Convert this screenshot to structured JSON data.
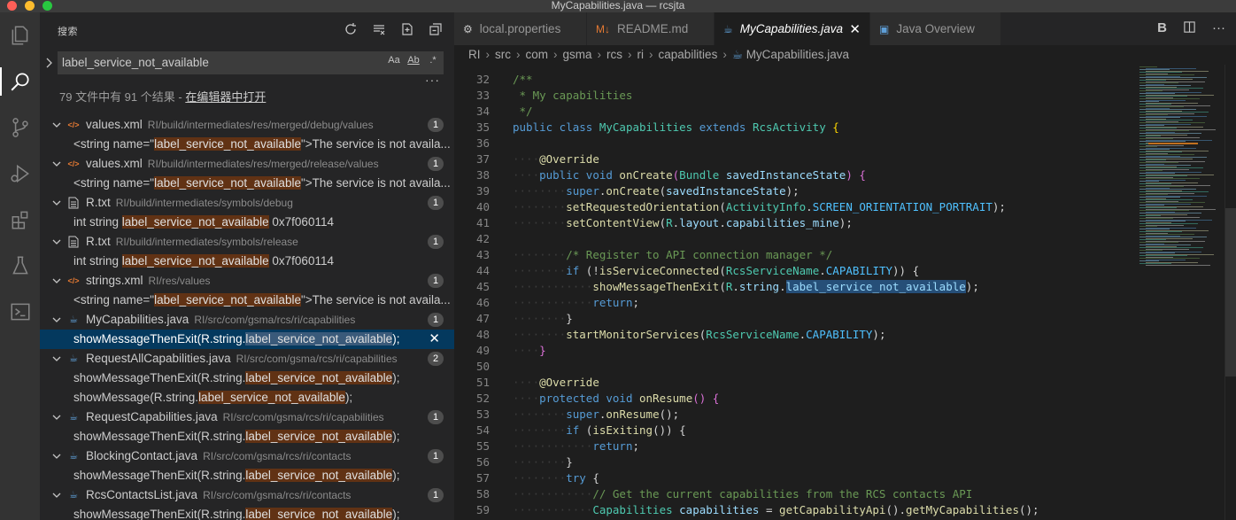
{
  "window": {
    "title": "MyCapabilities.java — rcsjta"
  },
  "activity_bar": [
    "files-icon",
    "search-icon",
    "source-control-icon",
    "run-debug-icon",
    "extensions-icon",
    "flask-icon",
    "terminal-icon"
  ],
  "sidebar": {
    "title": "搜索",
    "search": {
      "value": "label_service_not_available",
      "opt_case": "Aa",
      "opt_word": "Ab",
      "opt_regex": ".*"
    },
    "summary": {
      "text": "79 文件中有 91 个结果 - ",
      "link": "在编辑器中打开"
    },
    "results": [
      {
        "kind": "file",
        "icon": "xml",
        "name": "values.xml",
        "path": "RI/build/intermediates/res/merged/debug/values",
        "count": "1"
      },
      {
        "kind": "match",
        "pre": "<string name=\"",
        "hl": "label_service_not_available",
        "post": "\">The service is not availa..."
      },
      {
        "kind": "file",
        "icon": "xml",
        "name": "values.xml",
        "path": "RI/build/intermediates/res/merged/release/values",
        "count": "1"
      },
      {
        "kind": "match",
        "pre": "<string name=\"",
        "hl": "label_service_not_available",
        "post": "\">The service is not availa..."
      },
      {
        "kind": "file",
        "icon": "txt",
        "name": "R.txt",
        "path": "RI/build/intermediates/symbols/debug",
        "count": "1"
      },
      {
        "kind": "match",
        "pre": "int string ",
        "hl": "label_service_not_available",
        "post": " 0x7f060114"
      },
      {
        "kind": "file",
        "icon": "txt",
        "name": "R.txt",
        "path": "RI/build/intermediates/symbols/release",
        "count": "1"
      },
      {
        "kind": "match",
        "pre": "int string ",
        "hl": "label_service_not_available",
        "post": " 0x7f060114"
      },
      {
        "kind": "file",
        "icon": "xml",
        "name": "strings.xml",
        "path": "RI/res/values",
        "count": "1"
      },
      {
        "kind": "match",
        "pre": "<string name=\"",
        "hl": "label_service_not_available",
        "post": "\">The service is not availa..."
      },
      {
        "kind": "file",
        "icon": "java",
        "name": "MyCapabilities.java",
        "path": "RI/src/com/gsma/rcs/ri/capabilities",
        "count": "1"
      },
      {
        "kind": "match",
        "selected": true,
        "pre": "showMessageThenExit(R.string.",
        "hl": "label_service_not_available",
        "post": ");"
      },
      {
        "kind": "file",
        "icon": "java",
        "name": "RequestAllCapabilities.java",
        "path": "RI/src/com/gsma/rcs/ri/capabilities",
        "count": "2"
      },
      {
        "kind": "match",
        "pre": "showMessageThenExit(R.string.",
        "hl": "label_service_not_available",
        "post": ");"
      },
      {
        "kind": "match",
        "pre": "showMessage(R.string.",
        "hl": "label_service_not_available",
        "post": ");"
      },
      {
        "kind": "file",
        "icon": "java",
        "name": "RequestCapabilities.java",
        "path": "RI/src/com/gsma/rcs/ri/capabilities",
        "count": "1"
      },
      {
        "kind": "match",
        "pre": "showMessageThenExit(R.string.",
        "hl": "label_service_not_available",
        "post": ");"
      },
      {
        "kind": "file",
        "icon": "java",
        "name": "BlockingContact.java",
        "path": "RI/src/com/gsma/rcs/ri/contacts",
        "count": "1"
      },
      {
        "kind": "match",
        "pre": "showMessageThenExit(R.string.",
        "hl": "label_service_not_available",
        "post": ");"
      },
      {
        "kind": "file",
        "icon": "java",
        "name": "RcsContactsList.java",
        "path": "RI/src/com/gsma/rcs/ri/contacts",
        "count": "1"
      },
      {
        "kind": "match",
        "pre": "showMessageThenExit(R.string.",
        "hl": "label_service_not_available",
        "post": ");"
      }
    ]
  },
  "tabs": [
    {
      "label": "local.properties",
      "icon": "⚙",
      "active": false
    },
    {
      "label": "README.md",
      "icon": "M↓",
      "active": false
    },
    {
      "label": "MyCapabilities.java",
      "icon": "☕",
      "active": true
    },
    {
      "label": "Java Overview",
      "icon": "▣",
      "active": false
    }
  ],
  "tab_actions": [
    "B",
    "split-editor-icon",
    "more-icon"
  ],
  "breadcrumb": [
    "RI",
    "src",
    "com",
    "gsma",
    "rcs",
    "ri",
    "capabilities",
    "MyCapabilities.java"
  ],
  "code": [
    {
      "n": "32",
      "t": [
        [
          "c-com",
          "/**"
        ]
      ]
    },
    {
      "n": "33",
      "t": [
        [
          "c-com",
          " * My capabilities"
        ]
      ]
    },
    {
      "n": "34",
      "t": [
        [
          "c-com",
          " */"
        ]
      ]
    },
    {
      "n": "35",
      "t": [
        [
          "c-kw",
          "public"
        ],
        [
          "",
          ""
        ],
        [
          "c-kw",
          " class"
        ],
        [
          "c-cls",
          " MyCapabilities"
        ],
        [
          "c-kw",
          " extends"
        ],
        [
          "c-cls",
          " RcsActivity"
        ],
        [
          "c-brk",
          " {"
        ]
      ]
    },
    {
      "n": "36",
      "t": []
    },
    {
      "n": "37",
      "t": [
        [
          "ws",
          "····"
        ],
        [
          "c-ann",
          "@Override"
        ]
      ]
    },
    {
      "n": "38",
      "t": [
        [
          "ws",
          "····"
        ],
        [
          "c-kw",
          "public"
        ],
        [
          "c-kw",
          " void"
        ],
        [
          "c-fn",
          " onCreate"
        ],
        [
          "c-brk2",
          "("
        ],
        [
          "c-cls",
          "Bundle"
        ],
        [
          "c-var",
          " savedInstanceState"
        ],
        [
          "c-brk2",
          ")"
        ],
        [
          "c-brk2",
          " {"
        ]
      ]
    },
    {
      "n": "39",
      "t": [
        [
          "ws",
          "········"
        ],
        [
          "c-kw",
          "super"
        ],
        [
          "",
          "."
        ],
        [
          "c-fn",
          "onCreate"
        ],
        [
          "",
          "("
        ],
        [
          "c-var",
          "savedInstanceState"
        ],
        [
          "",
          ");"
        ]
      ]
    },
    {
      "n": "40",
      "t": [
        [
          "ws",
          "········"
        ],
        [
          "c-fn",
          "setRequestedOrientation"
        ],
        [
          "",
          "("
        ],
        [
          "c-cls",
          "ActivityInfo"
        ],
        [
          "",
          "."
        ],
        [
          "c-const",
          "SCREEN_ORIENTATION_PORTRAIT"
        ],
        [
          "",
          ");"
        ]
      ]
    },
    {
      "n": "41",
      "t": [
        [
          "ws",
          "········"
        ],
        [
          "c-fn",
          "setContentView"
        ],
        [
          "",
          "("
        ],
        [
          "c-cls",
          "R"
        ],
        [
          "",
          "."
        ],
        [
          "c-var",
          "layout"
        ],
        [
          "",
          "."
        ],
        [
          "c-var",
          "capabilities_mine"
        ],
        [
          "",
          ");"
        ]
      ]
    },
    {
      "n": "42",
      "t": []
    },
    {
      "n": "43",
      "t": [
        [
          "ws",
          "········"
        ],
        [
          "c-com",
          "/* Register to API connection manager */"
        ]
      ]
    },
    {
      "n": "44",
      "t": [
        [
          "ws",
          "········"
        ],
        [
          "c-kw",
          "if"
        ],
        [
          "",
          " ("
        ],
        [
          "",
          "!"
        ],
        [
          "c-fn",
          "isServiceConnected"
        ],
        [
          "",
          "("
        ],
        [
          "c-cls",
          "RcsServiceName"
        ],
        [
          "",
          "."
        ],
        [
          "c-const",
          "CAPABILITY"
        ],
        [
          "",
          "))"
        ],
        [
          "",
          " {"
        ]
      ]
    },
    {
      "n": "45",
      "t": [
        [
          "ws",
          "············"
        ],
        [
          "c-fn",
          "showMessageThenExit"
        ],
        [
          "",
          "("
        ],
        [
          "c-cls",
          "R"
        ],
        [
          "",
          "."
        ],
        [
          "c-var",
          "string"
        ],
        [
          "",
          "."
        ],
        [
          "c-var sel-hl",
          "label_service_not_available"
        ],
        [
          "",
          ");"
        ]
      ]
    },
    {
      "n": "46",
      "t": [
        [
          "ws",
          "············"
        ],
        [
          "c-kw",
          "return"
        ],
        [
          "",
          ";"
        ]
      ]
    },
    {
      "n": "47",
      "t": [
        [
          "ws",
          "········"
        ],
        [
          "",
          "}"
        ]
      ]
    },
    {
      "n": "48",
      "t": [
        [
          "ws",
          "········"
        ],
        [
          "c-fn",
          "startMonitorServices"
        ],
        [
          "",
          "("
        ],
        [
          "c-cls",
          "RcsServiceName"
        ],
        [
          "",
          "."
        ],
        [
          "c-const",
          "CAPABILITY"
        ],
        [
          "",
          ");"
        ]
      ]
    },
    {
      "n": "49",
      "t": [
        [
          "ws",
          "····"
        ],
        [
          "c-brk2",
          "}"
        ]
      ]
    },
    {
      "n": "50",
      "t": []
    },
    {
      "n": "51",
      "t": [
        [
          "ws",
          "····"
        ],
        [
          "c-ann",
          "@Override"
        ]
      ]
    },
    {
      "n": "52",
      "t": [
        [
          "ws",
          "····"
        ],
        [
          "c-kw",
          "protected"
        ],
        [
          "c-kw",
          " void"
        ],
        [
          "c-fn",
          " onResume"
        ],
        [
          "c-brk2",
          "()"
        ],
        [
          "c-brk2",
          " {"
        ]
      ]
    },
    {
      "n": "53",
      "t": [
        [
          "ws",
          "········"
        ],
        [
          "c-kw",
          "super"
        ],
        [
          "",
          "."
        ],
        [
          "c-fn",
          "onResume"
        ],
        [
          "",
          "();"
        ]
      ]
    },
    {
      "n": "54",
      "t": [
        [
          "ws",
          "········"
        ],
        [
          "c-kw",
          "if"
        ],
        [
          "",
          " ("
        ],
        [
          "c-fn",
          "isExiting"
        ],
        [
          "",
          "())"
        ],
        [
          "",
          " {"
        ]
      ]
    },
    {
      "n": "55",
      "t": [
        [
          "ws",
          "············"
        ],
        [
          "c-kw",
          "return"
        ],
        [
          "",
          ";"
        ]
      ]
    },
    {
      "n": "56",
      "t": [
        [
          "ws",
          "········"
        ],
        [
          "",
          "}"
        ]
      ]
    },
    {
      "n": "57",
      "t": [
        [
          "ws",
          "········"
        ],
        [
          "c-kw",
          "try"
        ],
        [
          "",
          " {"
        ]
      ]
    },
    {
      "n": "58",
      "t": [
        [
          "ws",
          "············"
        ],
        [
          "c-com",
          "// Get the current capabilities from the RCS contacts API"
        ]
      ]
    },
    {
      "n": "59",
      "t": [
        [
          "ws",
          "············"
        ],
        [
          "c-cls",
          "Capabilities"
        ],
        [
          "c-var",
          " capabilities"
        ],
        [
          "",
          " = "
        ],
        [
          "c-fn",
          "getCapabilityApi"
        ],
        [
          "",
          "()."
        ],
        [
          "c-fn",
          "getMyCapabilities"
        ],
        [
          "",
          "();"
        ]
      ]
    }
  ]
}
